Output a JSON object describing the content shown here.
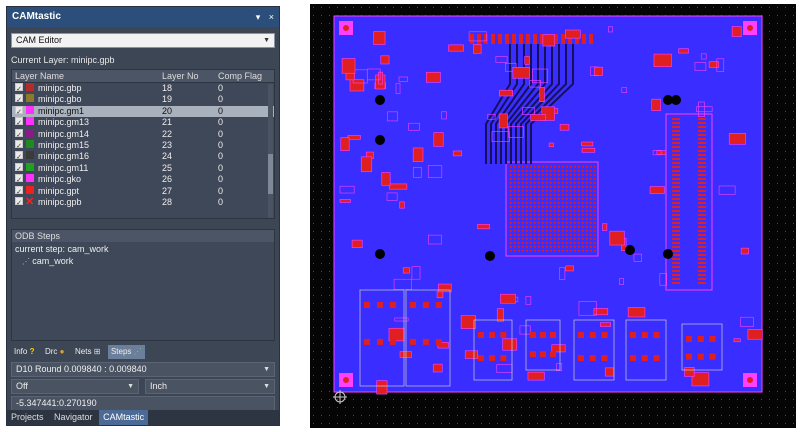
{
  "panel": {
    "title": "CAMtastic",
    "controls": [
      "▾",
      "×"
    ],
    "editor_select": "CAM Editor",
    "current_layer": "Current Layer: minipc.gpb",
    "columns": [
      "Layer Name",
      "Layer No",
      "Comp Flag"
    ],
    "layers": [
      {
        "name": "minipc.gbp",
        "no": "18",
        "flag": "0",
        "color": "#b52b2b"
      },
      {
        "name": "minipc.gbo",
        "no": "19",
        "flag": "0",
        "color": "#8a7a2a"
      },
      {
        "name": "minipc.gm1",
        "no": "20",
        "flag": "0",
        "color": "#ff30ff",
        "selected": true
      },
      {
        "name": "minipc.gm13",
        "no": "21",
        "flag": "0",
        "color": "#ff30ff"
      },
      {
        "name": "minipc.gm14",
        "no": "22",
        "flag": "0",
        "color": "#8a1a8a"
      },
      {
        "name": "minipc.gm15",
        "no": "23",
        "flag": "0",
        "color": "#1f8a1f"
      },
      {
        "name": "minipc.gm16",
        "no": "24",
        "flag": "0",
        "color": "#3a3a3a"
      },
      {
        "name": "minipc.gm11",
        "no": "25",
        "flag": "0",
        "color": "#22a022"
      },
      {
        "name": "minipc.gko",
        "no": "26",
        "flag": "0",
        "color": "#ff30ff"
      },
      {
        "name": "minipc.gpt",
        "no": "27",
        "flag": "0",
        "color": "#ee2020"
      },
      {
        "name": "minipc.gpb",
        "no": "28",
        "flag": "0",
        "color": "none"
      }
    ],
    "odb_title": "ODB Steps",
    "current_step": "current step: cam_work",
    "step_item": "cam_work",
    "tabs": [
      "Info",
      "Drc",
      "Nets",
      "Steps"
    ],
    "aperture": "D10   Round   0.009840 : 0.009840",
    "mode_select": "Off",
    "unit_select": "Inch",
    "coords": "-5.347441:0.270190",
    "bottom_tabs": [
      "Projects",
      "Navigator",
      "CAMtastic"
    ]
  },
  "pcb": {
    "board_color": "#3a2dff",
    "background_color": "#050505",
    "trace_color": "#e02020",
    "silk_color": "#ff40ff",
    "hole_color": "#000000"
  }
}
